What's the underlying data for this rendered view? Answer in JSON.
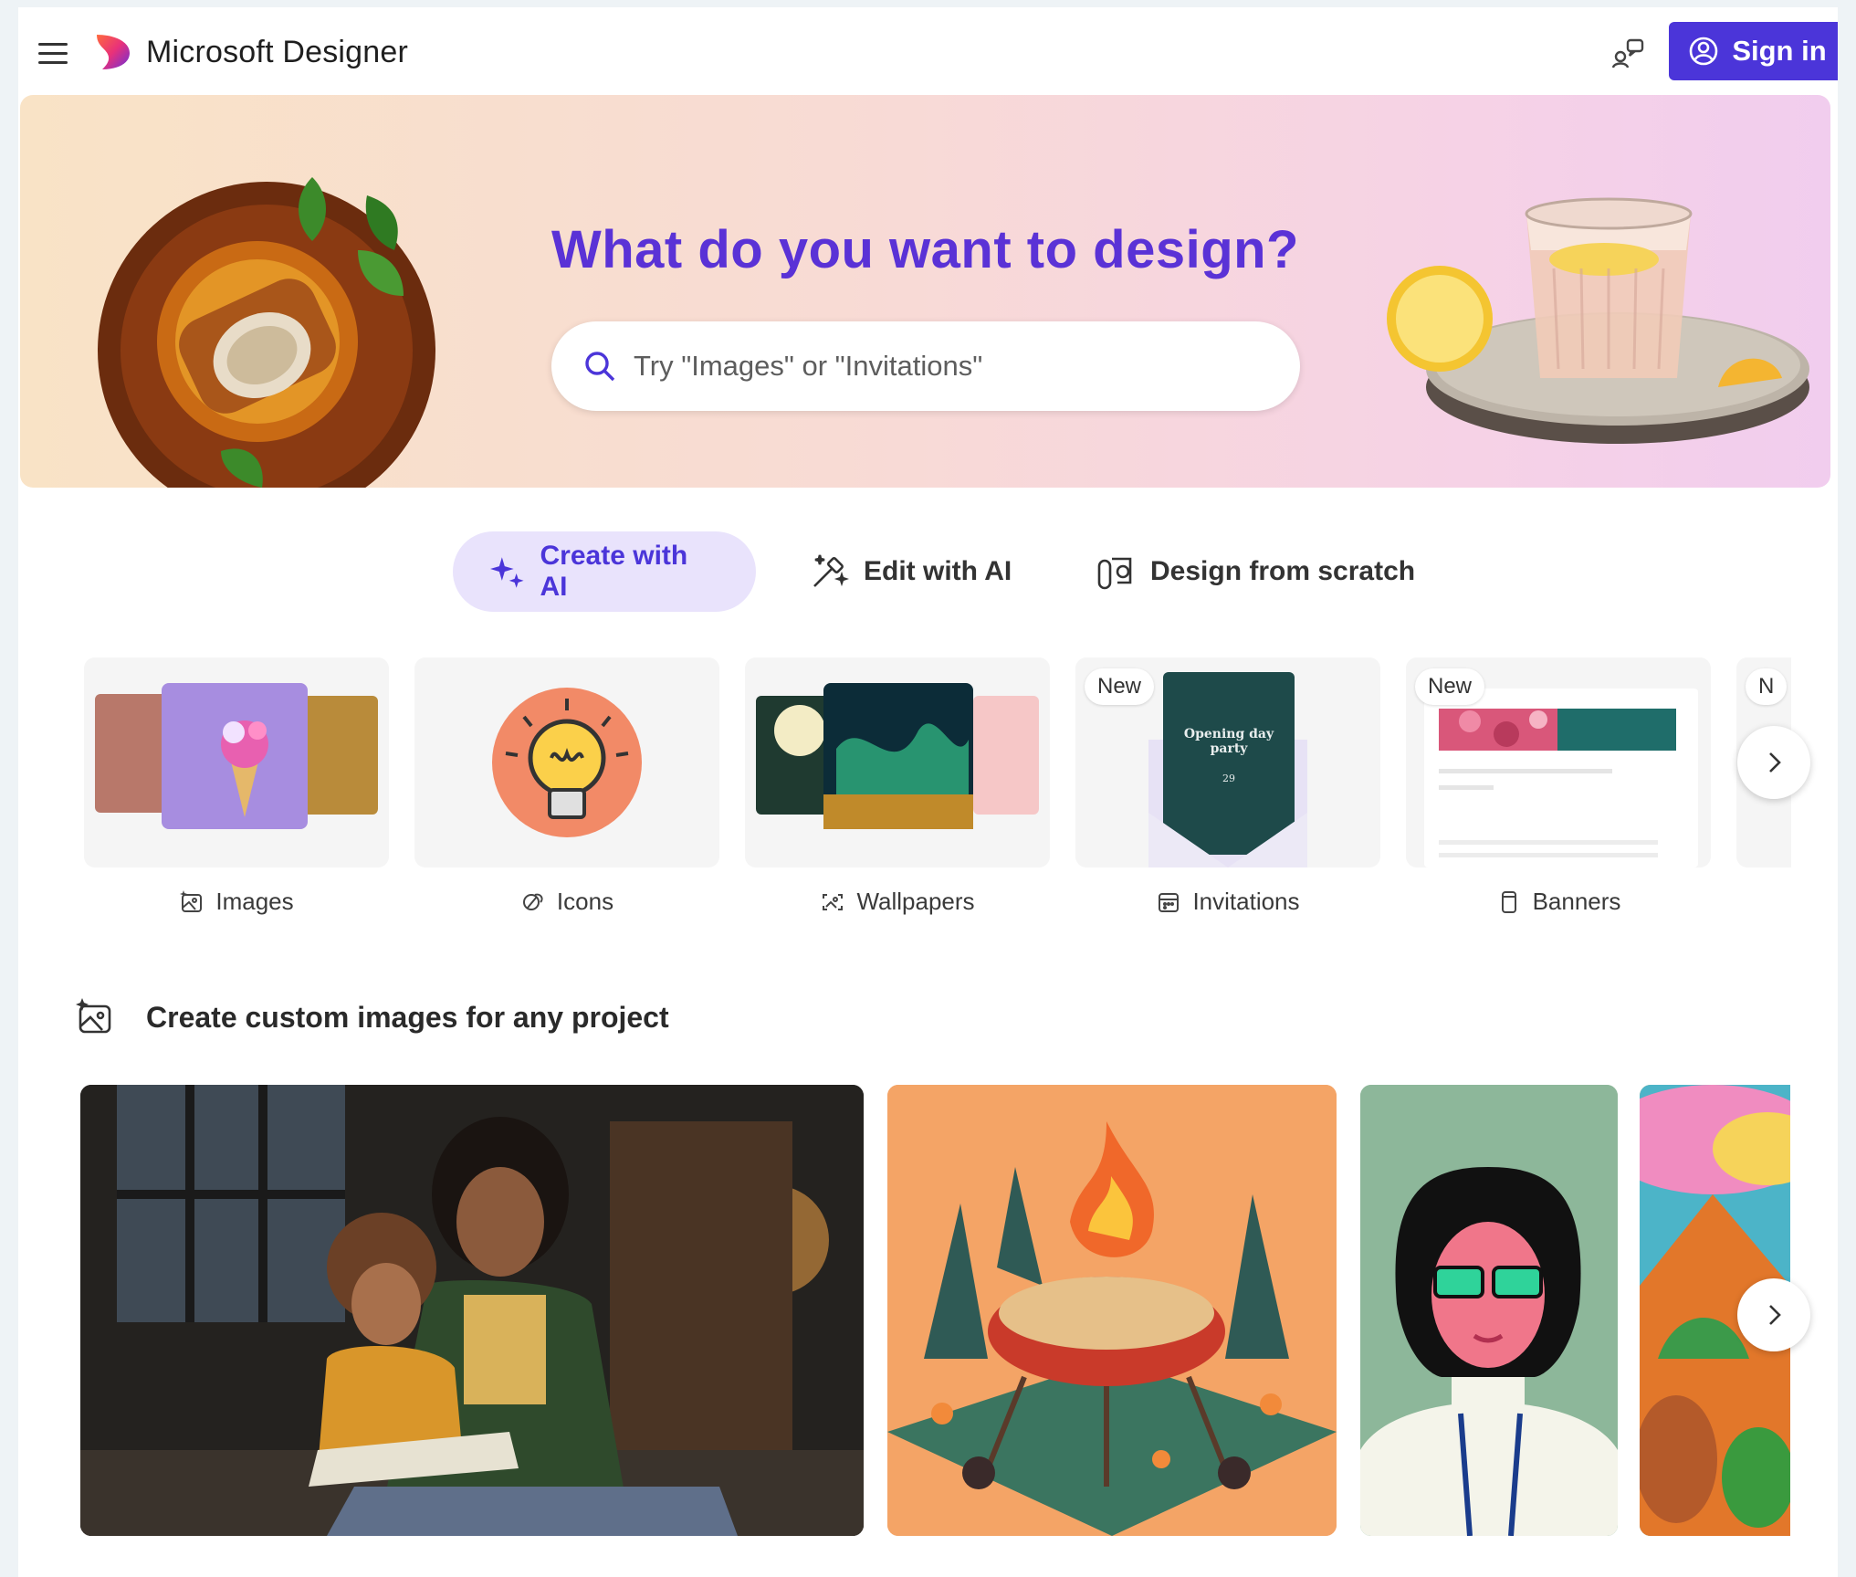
{
  "header": {
    "app_title": "Microsoft Designer",
    "signin_label": "Sign in"
  },
  "hero": {
    "title": "What do you want to design?",
    "search_placeholder": "Try \"Images\" or \"Invitations\""
  },
  "modes": [
    {
      "label": "Create with AI",
      "active": true
    },
    {
      "label": "Edit with AI",
      "active": false
    },
    {
      "label": "Design from scratch",
      "active": false
    }
  ],
  "categories": [
    {
      "label": "Images",
      "icon": "image-sparkle-icon",
      "badge": ""
    },
    {
      "label": "Icons",
      "icon": "icons-icon",
      "badge": ""
    },
    {
      "label": "Wallpapers",
      "icon": "wallpaper-icon",
      "badge": ""
    },
    {
      "label": "Invitations",
      "icon": "calendar-icon",
      "badge": "New"
    },
    {
      "label": "Banners",
      "icon": "banner-icon",
      "badge": "New"
    },
    {
      "label": "",
      "icon": "",
      "badge": "N"
    }
  ],
  "invitation_preview": {
    "line1": "Opening day",
    "line2": "party",
    "date": "29"
  },
  "section": {
    "title": "Create custom images for any project",
    "icon": "image-sparkle-icon"
  },
  "colors": {
    "brand": "#4b35d9",
    "hero_title": "#5a32d6",
    "active_tab_bg": "#e9e3fc"
  }
}
